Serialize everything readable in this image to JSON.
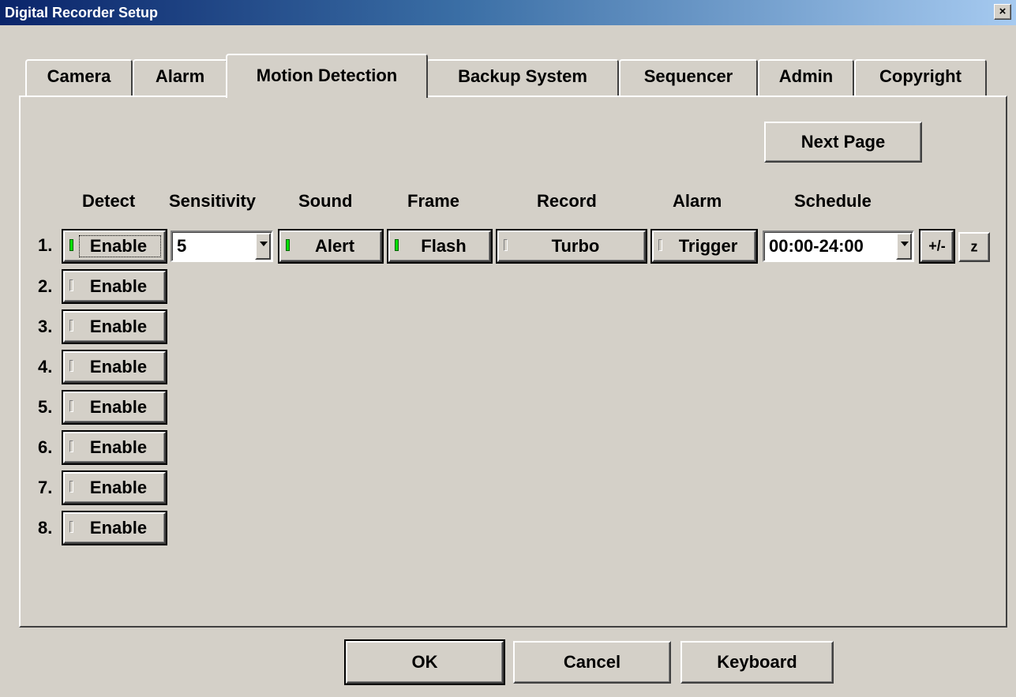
{
  "window": {
    "title": "Digital Recorder Setup",
    "close_label": "×"
  },
  "tabs": [
    {
      "label": "Camera"
    },
    {
      "label": "Alarm"
    },
    {
      "label": "Motion Detection",
      "active": true
    },
    {
      "label": "Backup System"
    },
    {
      "label": "Sequencer"
    },
    {
      "label": "Admin"
    },
    {
      "label": "Copyright"
    }
  ],
  "panel": {
    "next_page_label": "Next Page",
    "headers": {
      "detect": "Detect",
      "sensitivity": "Sensitivity",
      "sound": "Sound",
      "frame": "Frame",
      "record": "Record",
      "alarm": "Alarm",
      "schedule": "Schedule"
    },
    "row1": {
      "number": "1.",
      "detect_label": "Enable",
      "detect_on": true,
      "sensitivity_value": "5",
      "sound_label": "Alert",
      "sound_on": true,
      "frame_label": "Flash",
      "frame_on": true,
      "record_label": "Turbo",
      "record_on": false,
      "alarm_label": "Trigger",
      "alarm_on": false,
      "schedule_value": "00:00-24:00",
      "plus_minus_label": "+/-",
      "z_label": "z"
    },
    "rows": [
      {
        "number": "2.",
        "detect_label": "Enable",
        "detect_on": false
      },
      {
        "number": "3.",
        "detect_label": "Enable",
        "detect_on": false
      },
      {
        "number": "4.",
        "detect_label": "Enable",
        "detect_on": false
      },
      {
        "number": "5.",
        "detect_label": "Enable",
        "detect_on": false
      },
      {
        "number": "6.",
        "detect_label": "Enable",
        "detect_on": false
      },
      {
        "number": "7.",
        "detect_label": "Enable",
        "detect_on": false
      },
      {
        "number": "8.",
        "detect_label": "Enable",
        "detect_on": false
      }
    ]
  },
  "footer": {
    "ok_label": "OK",
    "cancel_label": "Cancel",
    "keyboard_label": "Keyboard"
  },
  "colors": {
    "face": "#d4d0c8",
    "led_on": "#00e000",
    "title_start": "#0a246a",
    "title_end": "#a6caf0"
  }
}
